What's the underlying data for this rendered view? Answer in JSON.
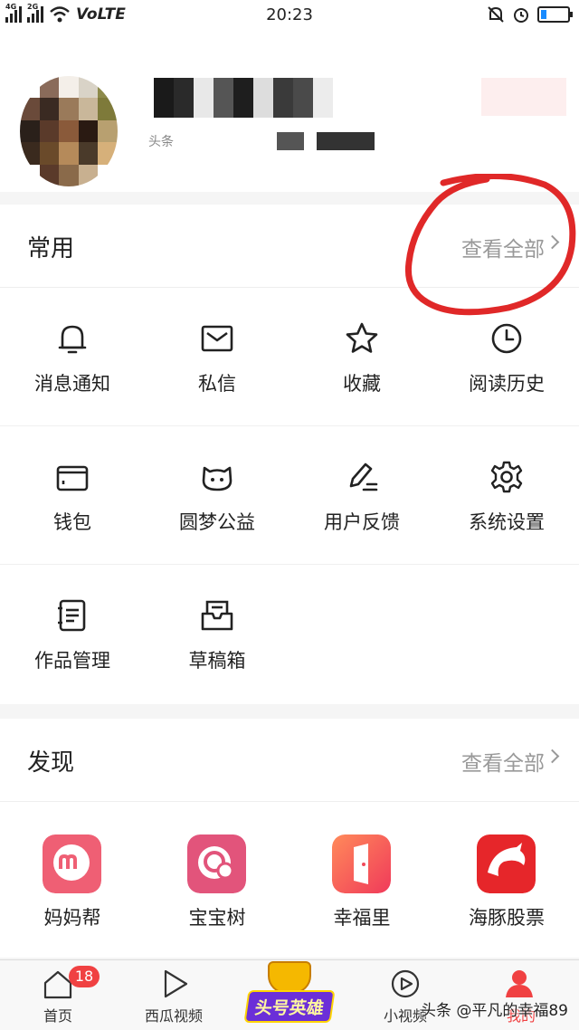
{
  "status_bar": {
    "network_1": "4G",
    "network_2": "2G",
    "volte": "VoLTE",
    "time": "20:23"
  },
  "profile": {
    "username_partial": "头条"
  },
  "common": {
    "title": "常用",
    "view_all": "查看全部",
    "items": [
      {
        "label": "消息通知",
        "icon": "bell-icon"
      },
      {
        "label": "私信",
        "icon": "mail-icon"
      },
      {
        "label": "收藏",
        "icon": "star-icon"
      },
      {
        "label": "阅读历史",
        "icon": "clock-icon"
      },
      {
        "label": "钱包",
        "icon": "wallet-icon"
      },
      {
        "label": "圆梦公益",
        "icon": "cat-face-icon"
      },
      {
        "label": "用户反馈",
        "icon": "pen-icon"
      },
      {
        "label": "系统设置",
        "icon": "gear-icon"
      },
      {
        "label": "作品管理",
        "icon": "notebook-icon"
      },
      {
        "label": "草稿箱",
        "icon": "draft-box-icon"
      }
    ]
  },
  "discover": {
    "title": "发现",
    "view_all": "查看全部",
    "apps": [
      {
        "label": "妈妈帮",
        "icon": "mamabang-icon",
        "color": "#ef5f74"
      },
      {
        "label": "宝宝树",
        "icon": "baobaoshu-icon",
        "color": "#e2547b"
      },
      {
        "label": "幸福里",
        "icon": "door-icon",
        "color": "#f2524c"
      },
      {
        "label": "海豚股票",
        "icon": "dolphin-icon",
        "color": "#e6262a"
      }
    ]
  },
  "tabbar": {
    "home": {
      "label": "首页",
      "badge": "18"
    },
    "xigua": {
      "label": "西瓜视频"
    },
    "hero": {
      "label": "头号英雄"
    },
    "short_video": {
      "label": "小视频"
    },
    "me": {
      "label": "我的"
    }
  },
  "watermark": "头条 @平凡的幸福89",
  "colors": {
    "accent": "#f04142",
    "annotation": "#e02828"
  }
}
